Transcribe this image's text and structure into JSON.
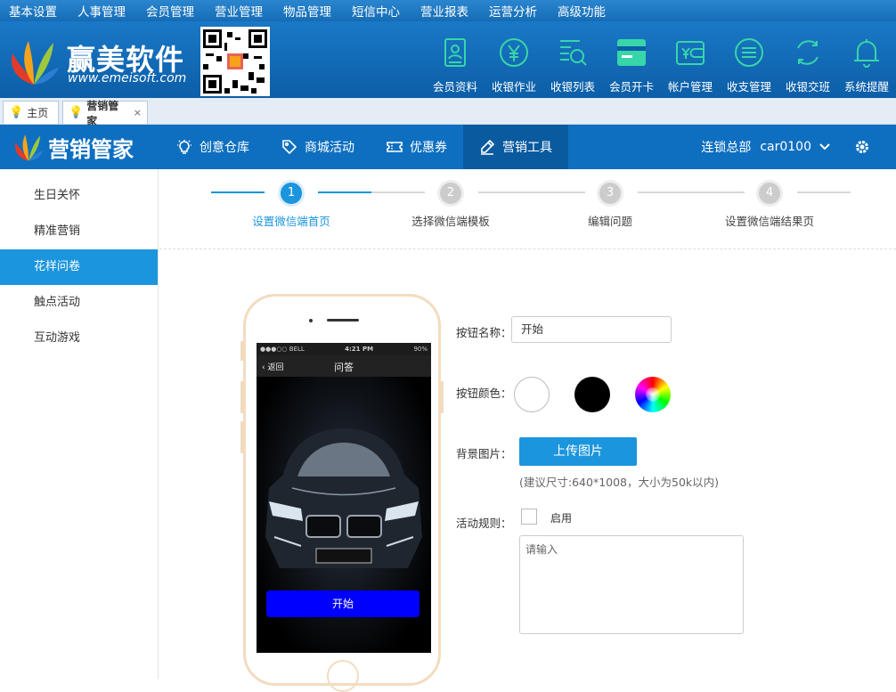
{
  "top_menu": [
    "基本设置",
    "人事管理",
    "会员管理",
    "营业管理",
    "物品管理",
    "短信中心",
    "营业报表",
    "运营分析",
    "高级功能"
  ],
  "brand": {
    "name": "赢美软件",
    "url": "www.emeisoft.com"
  },
  "header_icons": [
    {
      "label": "会员资料",
      "icon": "member-profile-icon"
    },
    {
      "label": "收银作业",
      "icon": "yen-coin-icon"
    },
    {
      "label": "收银列表",
      "icon": "list-search-icon"
    },
    {
      "label": "会员开卡",
      "icon": "card-icon"
    },
    {
      "label": "帐户管理",
      "icon": "wallet-icon"
    },
    {
      "label": "收支管理",
      "icon": "menu-circle-icon"
    },
    {
      "label": "收银交班",
      "icon": "refresh-circle-icon"
    },
    {
      "label": "系统提醒",
      "icon": "bell-icon"
    }
  ],
  "tabs": [
    {
      "label": "主页"
    },
    {
      "label": "营销管家",
      "close": "×"
    }
  ],
  "module": {
    "title": "营销管家",
    "nav": [
      {
        "label": "创意仓库",
        "icon": "bulb-icon"
      },
      {
        "label": "商城活动",
        "icon": "tag-icon"
      },
      {
        "label": "优惠券",
        "icon": "ticket-icon"
      },
      {
        "label": "营销工具",
        "icon": "pen-icon"
      }
    ],
    "store": "连锁总部",
    "account": "car0100"
  },
  "sidebar": [
    "生日关怀",
    "精准营销",
    "花样问卷",
    "触点活动",
    "互动游戏"
  ],
  "steps": [
    {
      "num": "1",
      "label": "设置微信端首页"
    },
    {
      "num": "2",
      "label": "选择微信端模板"
    },
    {
      "num": "3",
      "label": "编辑问题"
    },
    {
      "num": "4",
      "label": "设置微信端结果页"
    }
  ],
  "phone": {
    "carrier": "●●●○○ BELL",
    "time": "4:21 PM",
    "battery": "90%",
    "back": "返回",
    "title": "问答",
    "start_button": "开始"
  },
  "form": {
    "button_name_label": "按钮名称：",
    "button_name_value": "开始",
    "button_color_label": "按钮颜色：",
    "bg_label": "背景图片：",
    "upload_label": "上传图片",
    "hint": "(建议尺寸:640*1008，大小为50k以内)",
    "rule_label": "活动规则：",
    "enable_label": "启用",
    "textarea_placeholder": "请输入"
  },
  "colors": {
    "primary": "#1b95dd",
    "nav_bg": "#0e6fc0",
    "header_bg": "#1a78c6",
    "phone_button": "#0000ff"
  }
}
